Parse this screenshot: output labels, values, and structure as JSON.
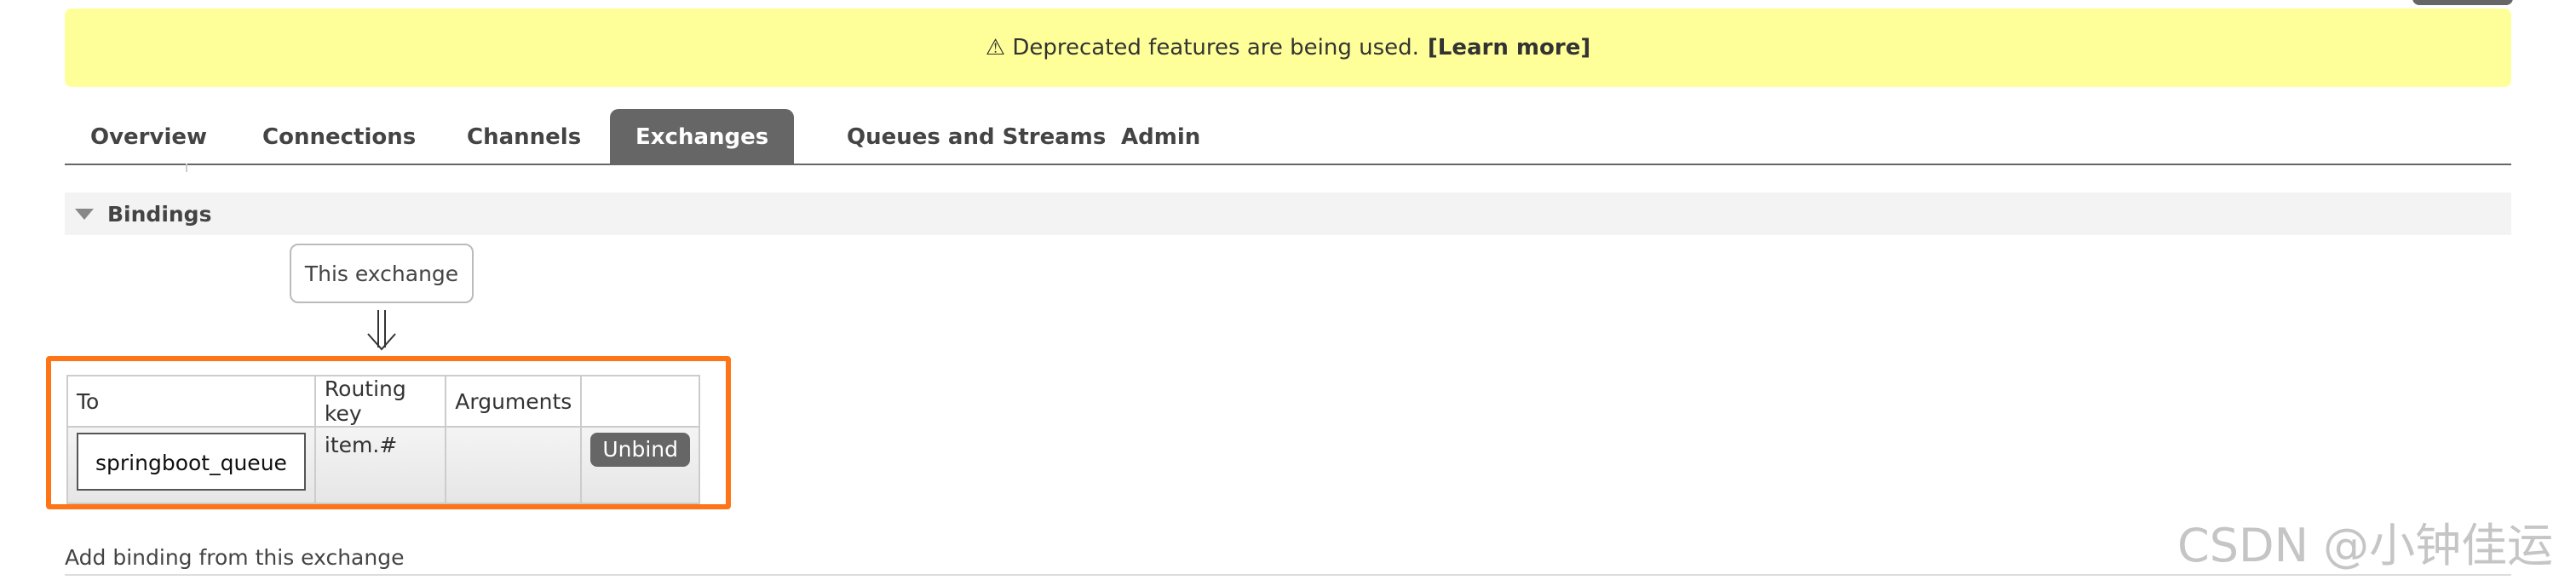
{
  "banner": {
    "icon": "warning-icon",
    "text": "⚠ Deprecated features are being used.",
    "link": "[Learn more]"
  },
  "nav": {
    "tabs": [
      {
        "label": "Overview",
        "active": false
      },
      {
        "label": "Connections",
        "active": false
      },
      {
        "label": "Channels",
        "active": false
      },
      {
        "label": "Exchanges",
        "active": true
      },
      {
        "label": "Queues and Streams",
        "active": false
      },
      {
        "label": "Admin",
        "active": false
      }
    ]
  },
  "bindings": {
    "title": "Bindings",
    "source_label": "This exchange",
    "columns": [
      "To",
      "Routing key",
      "Arguments",
      ""
    ],
    "rows": [
      {
        "to": "springboot_queue",
        "routing_key": "item.#",
        "arguments": "",
        "action": "Unbind"
      }
    ],
    "add_binding_label": "Add binding from this exchange"
  },
  "watermark": "CSDN @小钟佳运",
  "colors": {
    "banner_bg": "#ffff99",
    "active_tab_bg": "#666666",
    "highlight_border": "#ff7416"
  }
}
